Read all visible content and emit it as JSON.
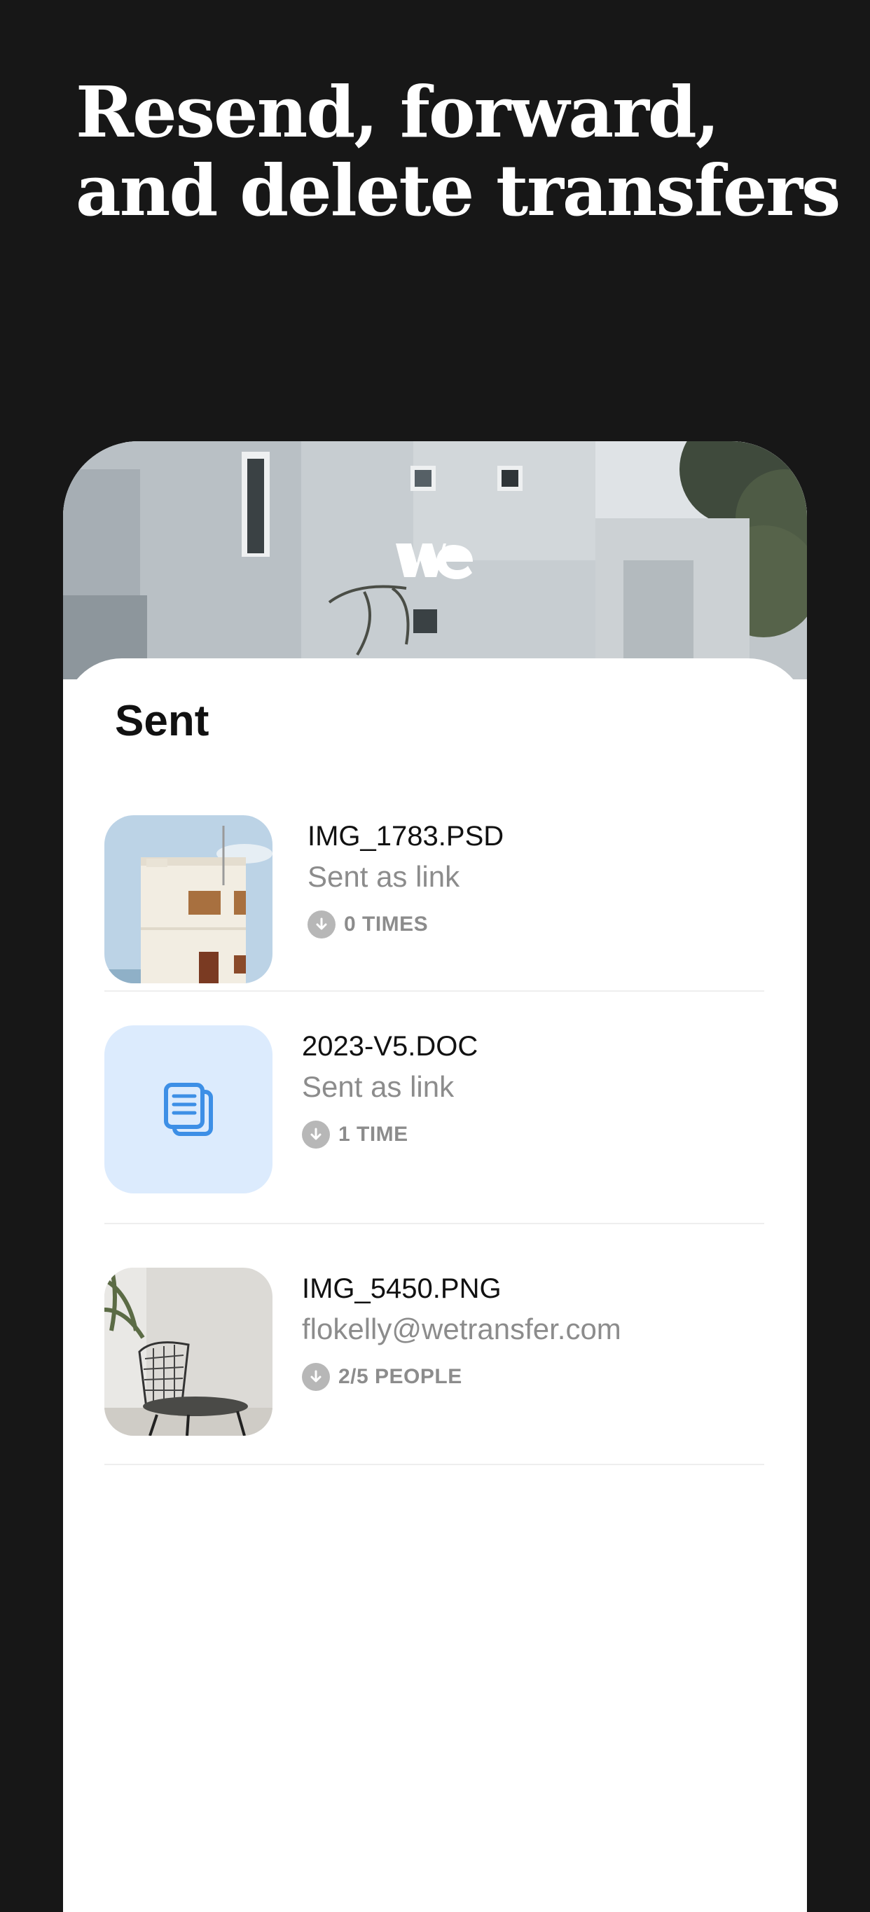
{
  "headline": {
    "line1": "Resend, forward,",
    "line2": "and delete transfers"
  },
  "app": {
    "logo_icon": "wetransfer-logo-icon",
    "sheet_title": "Sent"
  },
  "transfers": [
    {
      "filename": "IMG_1783.PSD",
      "subtitle": "Sent as link",
      "downloads": "0 TIMES",
      "thumbnail": "white-house-photo"
    },
    {
      "filename": "2023-V5.DOC",
      "subtitle": "Sent as link",
      "downloads": "1 TIME",
      "thumbnail": "document-icon"
    },
    {
      "filename": "IMG_5450.PNG",
      "subtitle": "flokelly@wetransfer.com",
      "downloads": "2/5 PEOPLE",
      "thumbnail": "wire-chair-photo"
    }
  ],
  "colors": {
    "background": "#171717",
    "doc_tile": "#dcebfd",
    "doc_icon": "#3d8fe6",
    "muted_text": "#8c8c8c"
  }
}
